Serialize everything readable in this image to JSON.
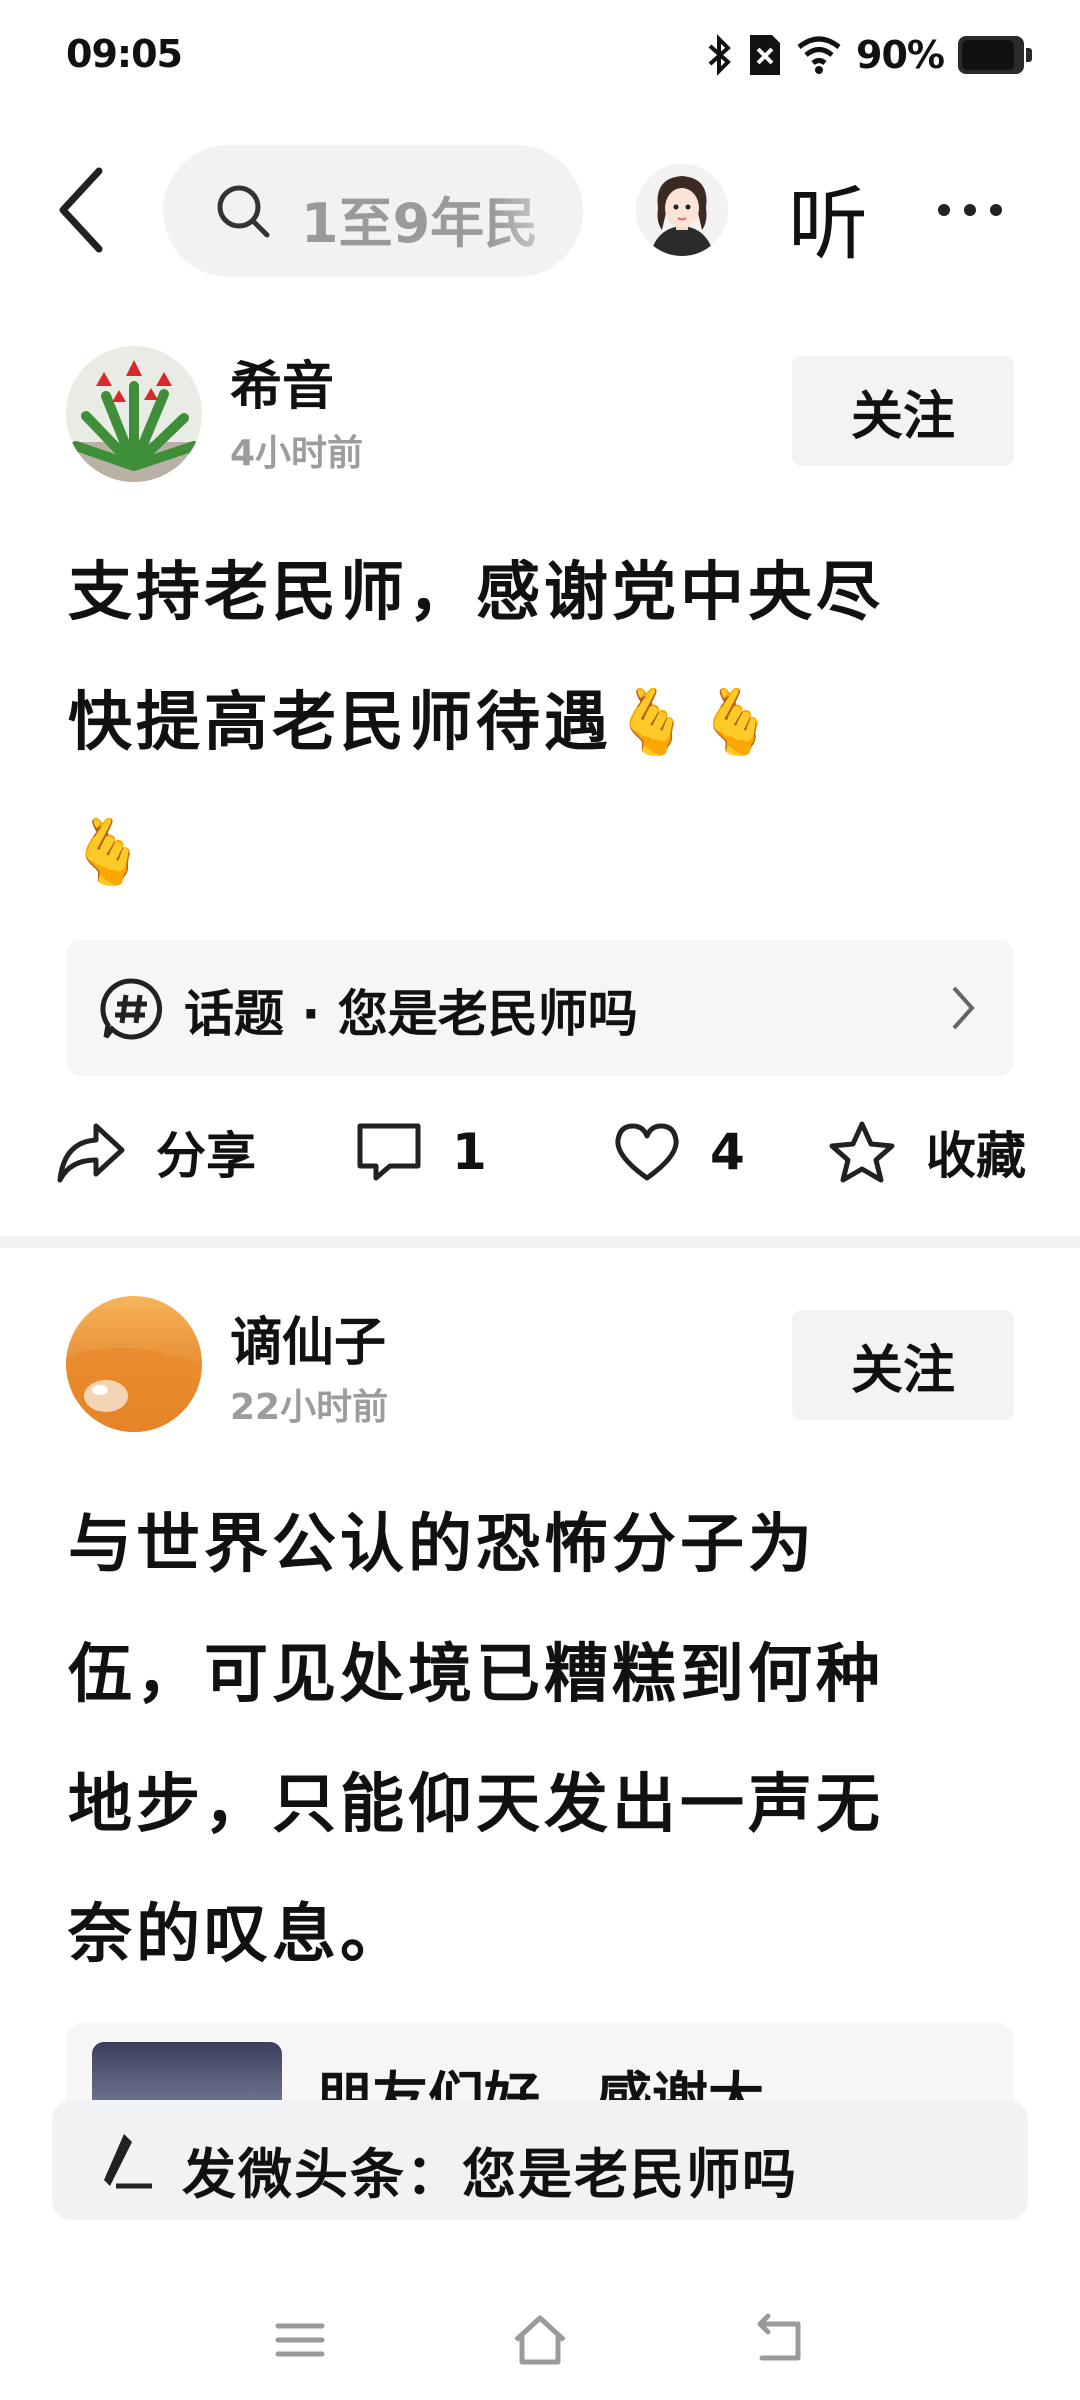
{
  "status_bar": {
    "time": "09:05",
    "battery": "90%",
    "battery_level": 0.9
  },
  "search": {
    "placeholder": "1至9年民"
  },
  "top_bar": {
    "listen_label": "听"
  },
  "posts": [
    {
      "author": "希音",
      "time": "4小时前",
      "follow_label": "关注",
      "lines": [
        "支持老民师，感谢党中央尽",
        "快提高老民师待遇🫰🫰",
        "🫰"
      ],
      "topic": "话题 · 您是老民师吗",
      "actions": {
        "share": "分享",
        "comments": "1",
        "likes": "4",
        "favorite": "收藏"
      }
    },
    {
      "author": "谪仙子",
      "time": "22小时前",
      "follow_label": "关注",
      "lines": [
        "与世界公认的恐怖分子为",
        "伍，可见处境已糟糕到何种",
        "地步，只能仰天发出一声无",
        "奈的叹息。"
      ],
      "preview_text": "朋友们好，感谢大"
    }
  ],
  "composer": {
    "text": "发微头条：您是老民师吗"
  }
}
